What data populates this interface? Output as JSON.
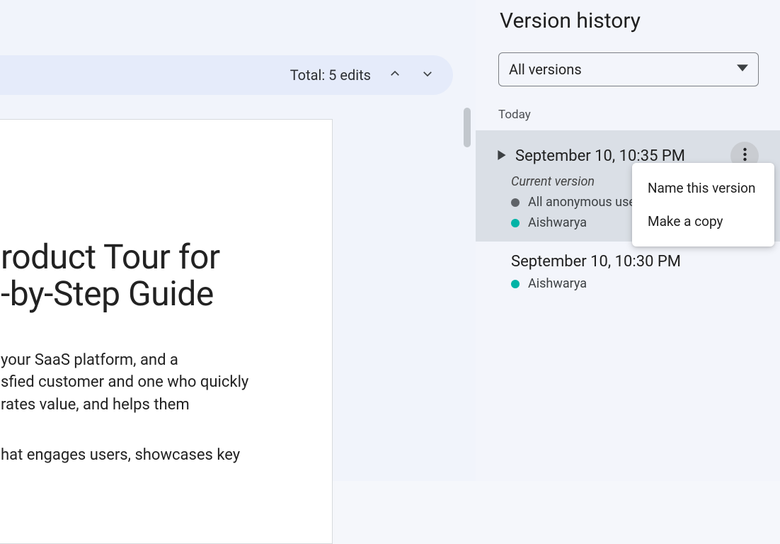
{
  "editsBar": {
    "label": "Total: 5 edits"
  },
  "document": {
    "title": "roduct Tour for\n-by-Step Guide",
    "para1": " your SaaS platform, and a\nsfied customer and one who quickly\nrates value, and helps them",
    "para2": "hat engages users, showcases key"
  },
  "sidebar": {
    "title": "Version history",
    "filter": {
      "label": "All versions"
    },
    "group": "Today",
    "versions": [
      {
        "timestamp": "September 10, 10:35 PM",
        "currentLabel": "Current version",
        "editors": [
          {
            "name": "All anonymous users",
            "color": "gray"
          },
          {
            "name": "Aishwarya",
            "color": "teal"
          }
        ]
      },
      {
        "timestamp": "September 10, 10:30 PM",
        "editors": [
          {
            "name": "Aishwarya",
            "color": "teal"
          }
        ]
      }
    ]
  },
  "menu": {
    "items": [
      "Name this version",
      "Make a copy"
    ]
  }
}
